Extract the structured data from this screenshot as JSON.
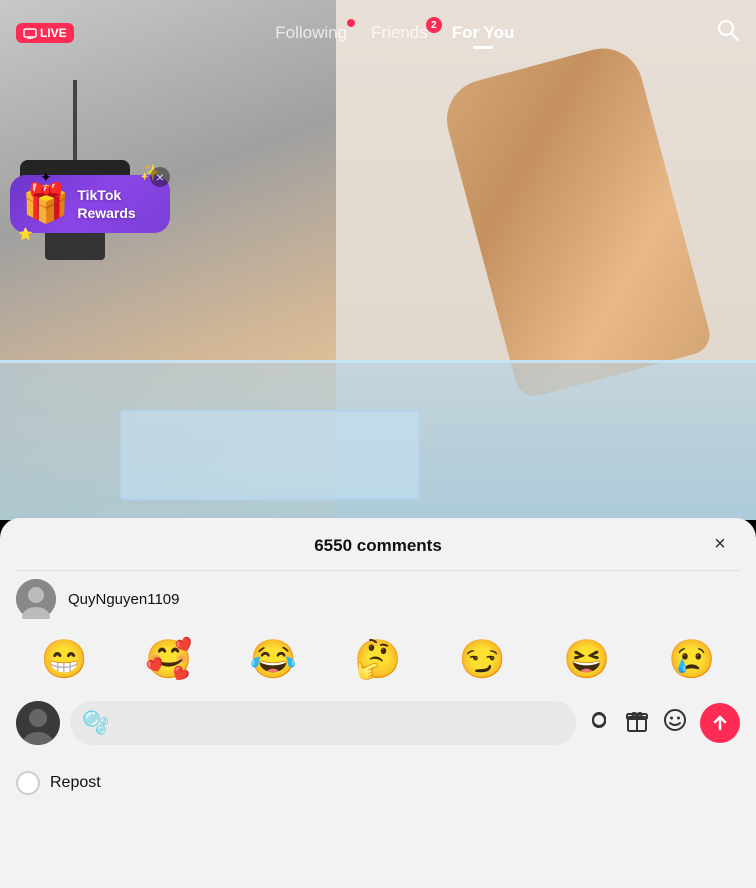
{
  "nav": {
    "live_label": "LIVE",
    "tabs": [
      {
        "id": "following",
        "label": "Following",
        "active": false,
        "dot": true,
        "badge": null
      },
      {
        "id": "friends",
        "label": "Friends",
        "active": false,
        "dot": false,
        "badge": "2"
      },
      {
        "id": "for_you",
        "label": "For You",
        "active": true,
        "dot": false,
        "badge": null
      }
    ]
  },
  "rewards": {
    "emojis": "🎁🎀",
    "line1": "TikTok",
    "line2": "Rewards",
    "close_label": "×"
  },
  "comments": {
    "title": "6550 comments",
    "close_label": "×",
    "username": "QuyNguyen1109"
  },
  "emojis": {
    "items": [
      "😁",
      "🥰",
      "😂",
      "🤔",
      "😏",
      "😆",
      "😢"
    ]
  },
  "input": {
    "placeholder": "",
    "blob_emoji": "🫧",
    "at_icon": "@",
    "gift_icon": "🎁",
    "face_icon": "🙂"
  },
  "repost": {
    "label": "Repost"
  }
}
